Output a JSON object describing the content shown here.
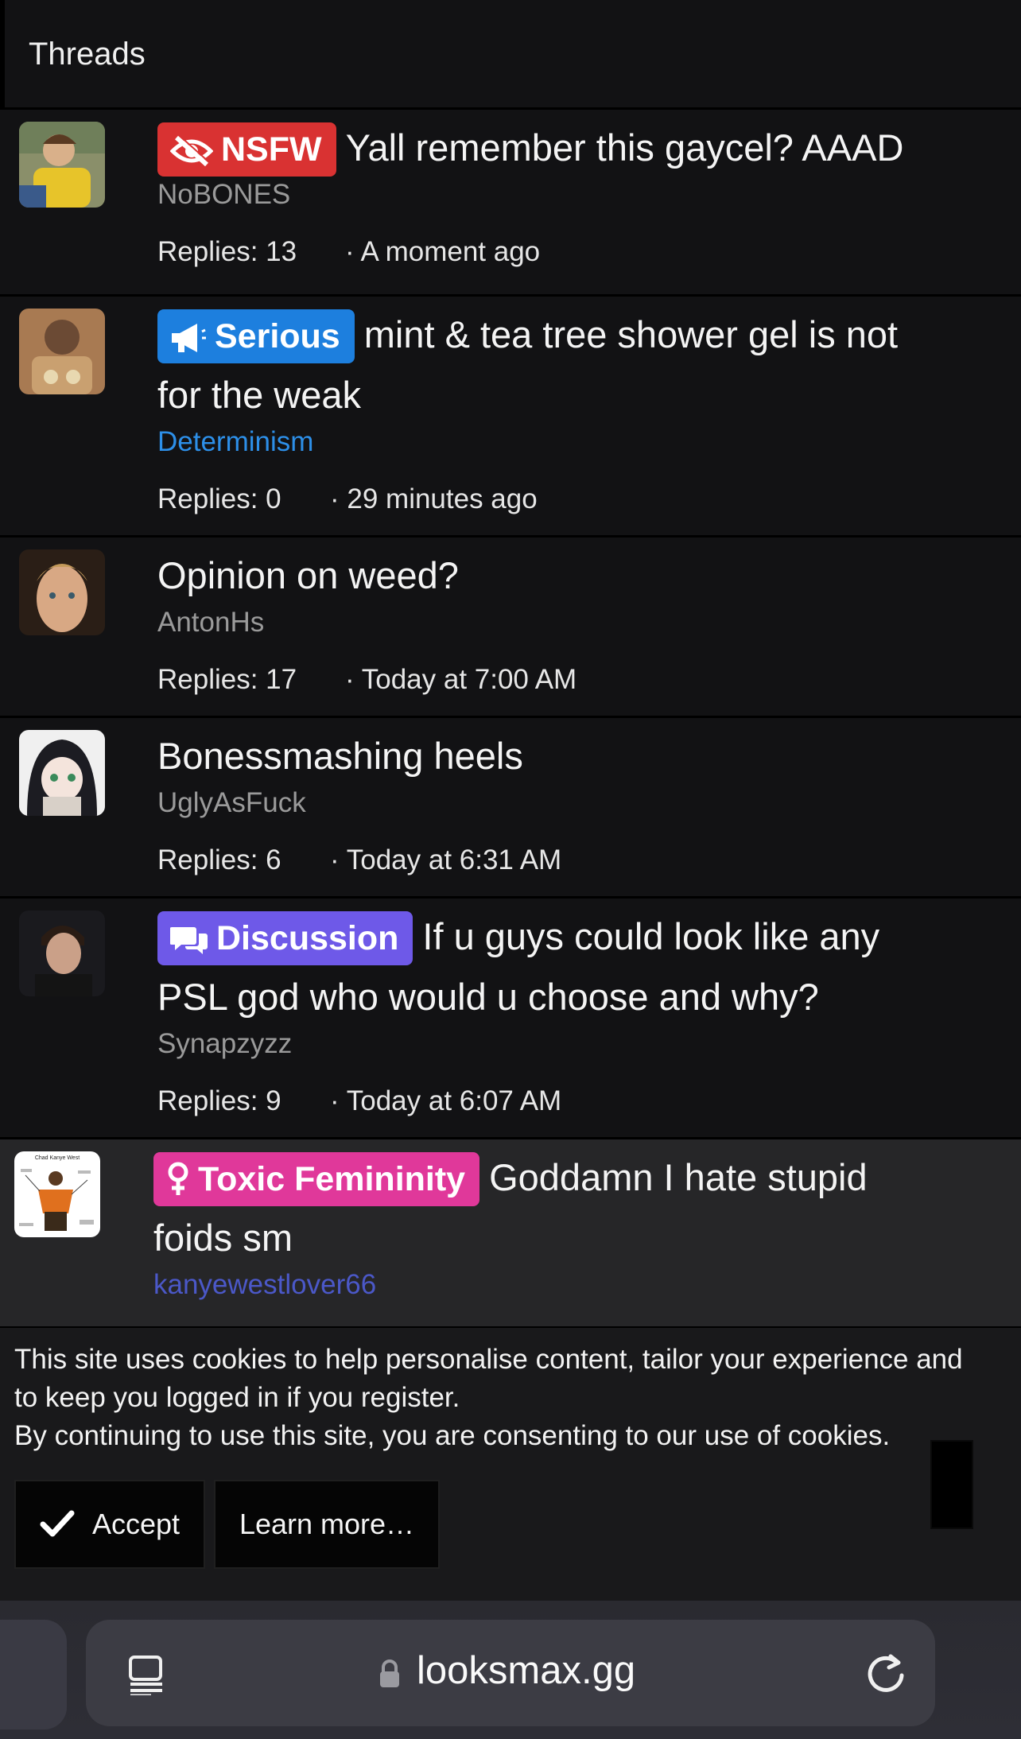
{
  "header": {
    "title": "Threads"
  },
  "threads": [
    {
      "prefix": "NSFW",
      "prefix_icon": "eye-slash-icon",
      "prefix_color": "#d93232",
      "title_part1": "Yall remember this gaycel? AAAD",
      "title_part2": "",
      "author": "NoBONES",
      "replies": "Replies: 13",
      "time": "· A moment ago"
    },
    {
      "prefix": "Serious",
      "prefix_icon": "bullhorn-icon",
      "prefix_color": "#1d7fde",
      "title_part1": "mint & tea tree shower gel is not",
      "title_part2": "for the weak",
      "author": "Determinism",
      "replies": "Replies: 0",
      "time": "· 29 minutes ago"
    },
    {
      "prefix": "",
      "title_part1": "Opinion on weed?",
      "title_part2": "",
      "author": "AntonHs",
      "replies": "Replies: 17",
      "time": "· Today at 7:00 AM"
    },
    {
      "prefix": "",
      "title_part1": "Bonessmashing heels",
      "title_part2": "",
      "author": "UglyAsFuck",
      "replies": "Replies: 6",
      "time": "· Today at 6:31 AM"
    },
    {
      "prefix": "Discussion",
      "prefix_icon": "comments-icon",
      "prefix_color": "#6e59e8",
      "title_part1": "If u guys could look like any",
      "title_part2": "PSL god who would u choose and why?",
      "author": "Synapzyzz",
      "replies": "Replies: 9",
      "time": "· Today at 6:07 AM"
    },
    {
      "prefix": "Toxic Femininity",
      "prefix_icon": "venus-icon",
      "prefix_color": "#e0389a",
      "title_part1": "Goddamn I hate stupid",
      "title_part2": "foids sm",
      "author": "kanyewestlover66",
      "avatar_caption": "Chad Kanye West"
    }
  ],
  "cookie": {
    "line1": "This site uses cookies to help personalise content, tailor your experience and",
    "line2": "to keep you logged in if you register.",
    "line3": "By continuing to use this site, you are consenting to our use of cookies.",
    "accept_label": "Accept",
    "learn_label": "Learn more…"
  },
  "browser": {
    "url": "looksmax.gg"
  }
}
